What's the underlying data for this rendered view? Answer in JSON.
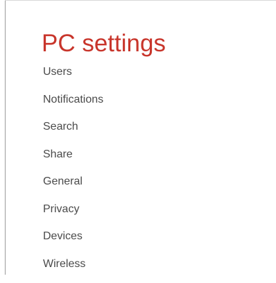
{
  "header": {
    "title": "PC settings"
  },
  "nav": {
    "items": [
      {
        "label": "Users"
      },
      {
        "label": "Notifications"
      },
      {
        "label": "Search"
      },
      {
        "label": "Share"
      },
      {
        "label": "General"
      },
      {
        "label": "Privacy"
      },
      {
        "label": "Devices"
      },
      {
        "label": "Wireless"
      }
    ]
  },
  "colors": {
    "accent": "#c8352b",
    "text": "#4a4a4a",
    "background": "#ffffff"
  }
}
